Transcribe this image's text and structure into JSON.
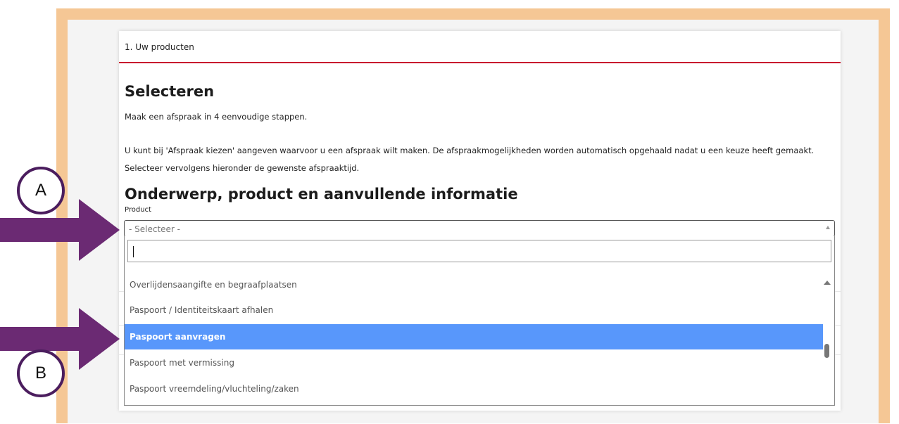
{
  "step": {
    "title": "1. Uw producten"
  },
  "content": {
    "heading": "Selecteren",
    "intro": "Maak een afspraak in 4 eenvoudige stappen.",
    "description": "U kunt bij 'Afspraak kiezen' aangeven waarvoor u een afspraak wilt maken. De afspraakmogelijkheden worden automatisch opgehaald nadat u een keuze heeft gemaakt. Selecteer vervolgens hieronder de gewenste afspraaktijd.",
    "section_heading": "Onderwerp, product en aanvullende informatie",
    "field_label": "Product"
  },
  "select": {
    "value": "- Selecteer -"
  },
  "dropdown": {
    "search_value": "",
    "options": [
      {
        "label": "Overlijdensaangifte en begraafplaatsen"
      },
      {
        "label": "Paspoort / Identiteitskaart afhalen"
      },
      {
        "label": "Paspoort aanvragen",
        "selected": true
      },
      {
        "label": "Paspoort met vermissing"
      },
      {
        "label": "Paspoort vreemdeling/vluchteling/zaken"
      }
    ]
  },
  "annotations": {
    "a": "A",
    "b": "B"
  },
  "colors": {
    "frame": "#f5c795",
    "header_rule": "#c8102e",
    "selected_option": "#5897fb",
    "arrow": "#6b2a73",
    "circle_border": "#4b1d5e"
  }
}
